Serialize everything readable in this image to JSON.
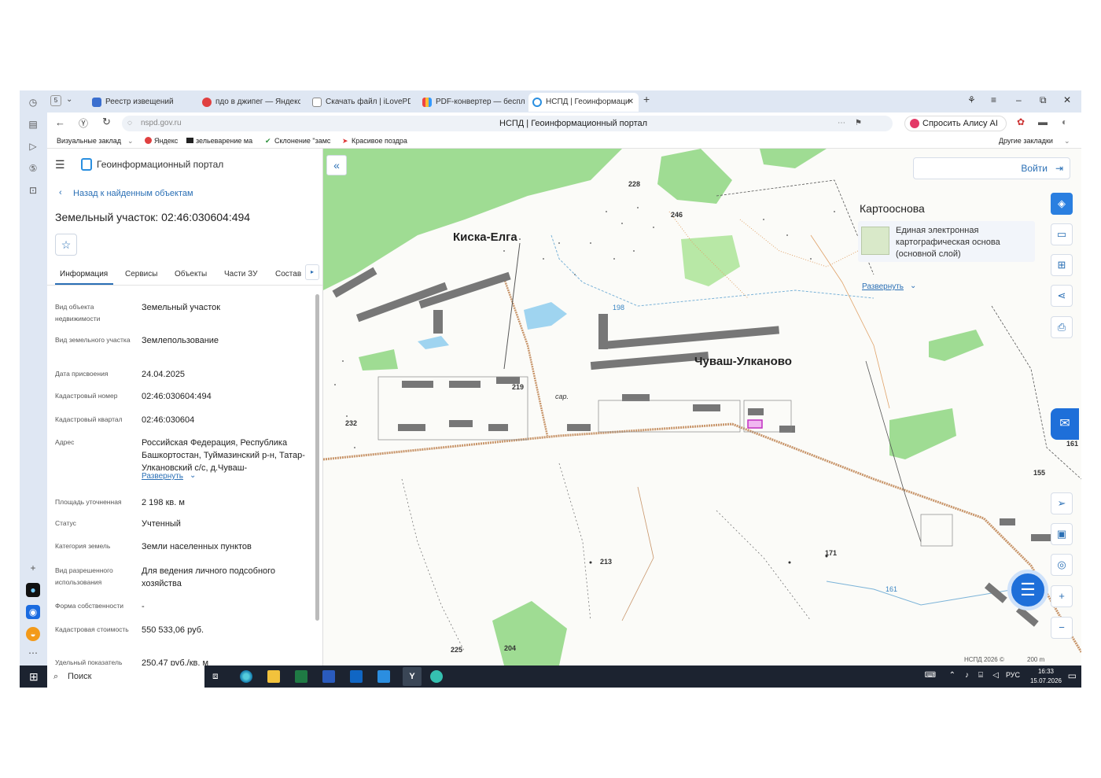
{
  "browser": {
    "tab_count_badge": "5",
    "tabs": [
      {
        "label": "Реестр извещений",
        "active": false
      },
      {
        "label": "пдо в джипег — Яндекс: н",
        "active": false
      },
      {
        "label": "Скачать файл | iLovePDF",
        "active": false
      },
      {
        "label": "PDF-конвертер — беспла",
        "active": false
      },
      {
        "label": "НСПД | Геоинформаци",
        "active": true
      }
    ],
    "url": "nspd.gov.ru",
    "page_title": "НСПД | Геоинформационный портал",
    "alice_label": "Спросить Алису AI",
    "bookmarks": [
      "Визуальные заклад",
      "Яндекс",
      "зельеварение ма",
      "Склонение \"замс",
      "Красивое поздра"
    ],
    "other_bookmarks": "Другие закладки"
  },
  "panel": {
    "portal_title": "Геоинформационный портал",
    "back_link": "Назад к найденным объектам",
    "object_title": "Земельный участок: 02:46:030604:494",
    "tabs": [
      "Информация",
      "Сервисы",
      "Объекты",
      "Части ЗУ",
      "Состав"
    ],
    "rows": [
      {
        "key": "Вид объекта недвижимости",
        "value": "Земельный участок"
      },
      {
        "key": "Вид земельного участка",
        "value": "Землепользование"
      },
      {
        "key": "Дата присвоения",
        "value": "24.04.2025"
      },
      {
        "key": "Кадастровый номер",
        "value": "02:46:030604:494"
      },
      {
        "key": "Кадастровый квартал",
        "value": "02:46:030604"
      },
      {
        "key": "Адрес",
        "value": "Российская Федерация, Республика Башкортостан, Туймазинский р-н, Татар-Улкановский с/с, д.Чуваш-"
      },
      {
        "key": "Площадь уточненная",
        "value": "2 198 кв. м"
      },
      {
        "key": "Статус",
        "value": "Учтенный"
      },
      {
        "key": "Категория земель",
        "value": "Земли населенных пунктов"
      },
      {
        "key": "Вид разрешенного использования",
        "value": "Для ведения личного подсобного хозяйства"
      },
      {
        "key": "Форма собственности",
        "value": "-"
      },
      {
        "key": "Кадастровая стоимость",
        "value": "550 533,06 руб."
      },
      {
        "key": "Удельный показатель",
        "value": "250,47 руб./кв. м"
      }
    ],
    "expand_label": "Развернуть"
  },
  "map": {
    "login_label": "Войти",
    "basemap_title": "Картооснова",
    "basemap_name": "Единая электронная картографическая основа (основной слой)",
    "basemap_expand": "Развернуть",
    "places": [
      "Киска-Елга",
      "Чуваш-Улканово"
    ],
    "heights": [
      "228",
      "246",
      "232",
      "219",
      "213",
      "225",
      "204",
      "171",
      "161",
      "155",
      "198",
      "161"
    ],
    "abbrev": "сар.",
    "attribution": "НСПД 2026 ©",
    "scale": "200 m"
  },
  "taskbar": {
    "search_label": "Поиск",
    "lang": "РУС",
    "time": "16:33",
    "date": "15.07.2026"
  }
}
